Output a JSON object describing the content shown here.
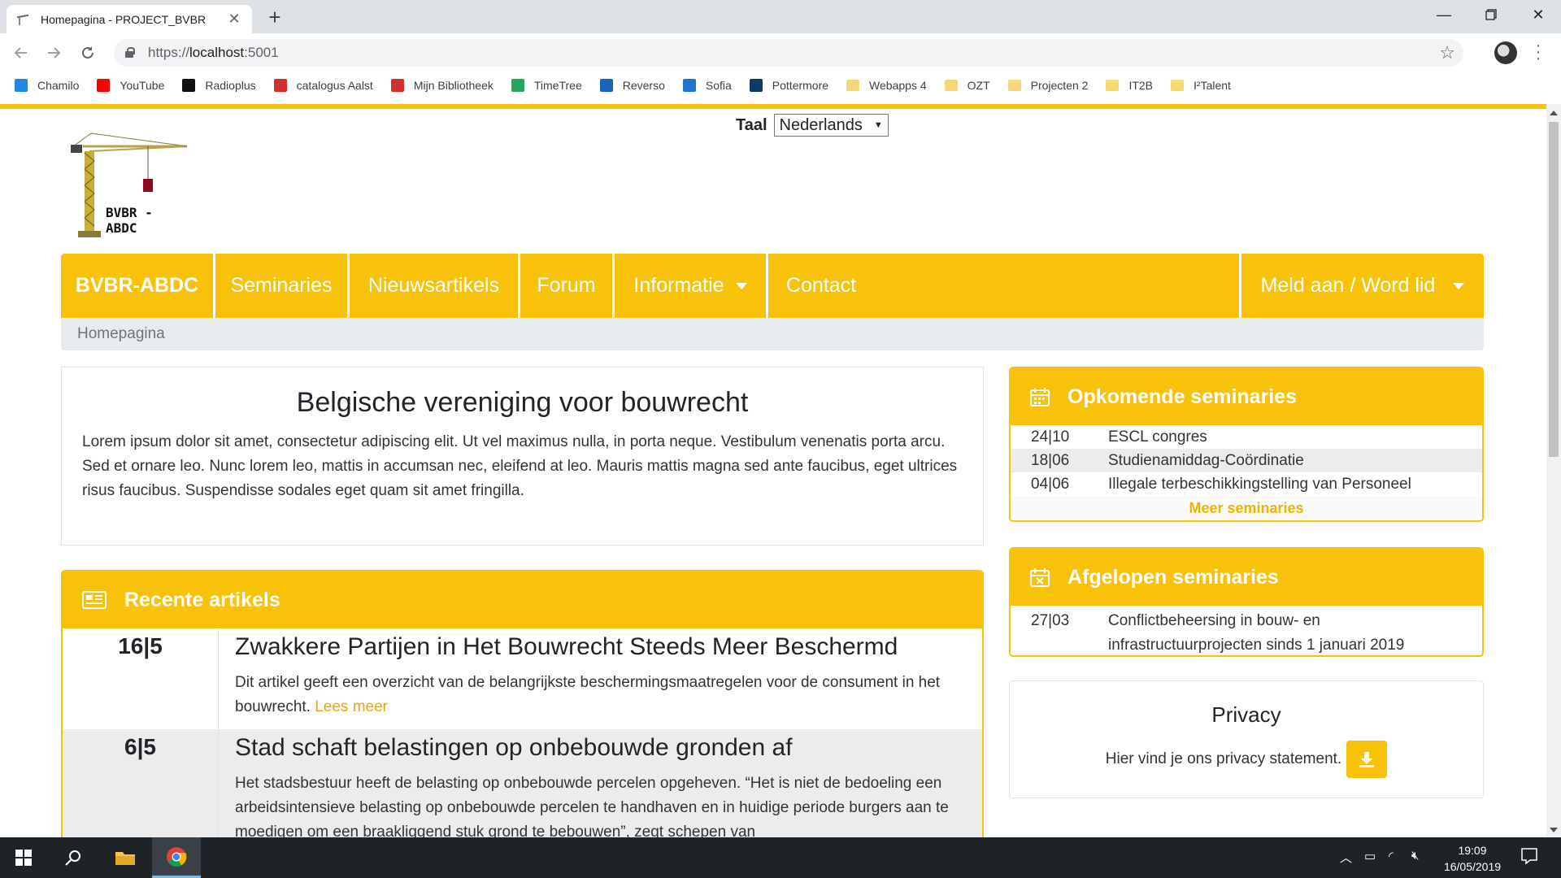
{
  "browser": {
    "tab_title": "Homepagina - PROJECT_BVBR",
    "url_scheme": "https://",
    "url_host": "localhost",
    "url_port": ":5001",
    "bookmarks": [
      {
        "label": "Chamilo",
        "icon": "chamilo-icon",
        "color": "#1e88e5"
      },
      {
        "label": "YouTube",
        "icon": "youtube-icon",
        "color": "#ff0000"
      },
      {
        "label": "Radioplus",
        "icon": "radioplus-icon",
        "color": "#111111"
      },
      {
        "label": "catalogus Aalst",
        "icon": "bib-icon",
        "color": "#d32f2f"
      },
      {
        "label": "Mijn Bibliotheek",
        "icon": "bib-icon",
        "color": "#d32f2f"
      },
      {
        "label": "TimeTree",
        "icon": "timetree-icon",
        "color": "#26a65b"
      },
      {
        "label": "Reverso",
        "icon": "reverso-icon",
        "color": "#1565c0"
      },
      {
        "label": "Sofia",
        "icon": "sofia-icon",
        "color": "#1976d2"
      },
      {
        "label": "Pottermore",
        "icon": "pottermore-icon",
        "color": "#0d3b66"
      },
      {
        "label": "Webapps 4",
        "icon": "folder-icon",
        "color": "#f7d775"
      },
      {
        "label": "OZT",
        "icon": "folder-icon",
        "color": "#f7d775"
      },
      {
        "label": "Projecten 2",
        "icon": "folder-icon",
        "color": "#f7d775"
      },
      {
        "label": "IT2B",
        "icon": "folder-icon",
        "color": "#f7d775"
      },
      {
        "label": "I²Talent",
        "icon": "folder-icon",
        "color": "#f7d775"
      }
    ]
  },
  "page": {
    "accent_color": "#f8c20b",
    "language": {
      "label": "Taal",
      "value": "Nederlands"
    },
    "logo_text": "BVBR - ABDC",
    "nav": {
      "brand": "BVBR-ABDC",
      "items": [
        "Seminaries",
        "Nieuwsartikels",
        "Forum",
        "Informatie",
        "Contact"
      ],
      "account": "Meld aan / Word lid"
    },
    "breadcrumb": "Homepagina",
    "intro": {
      "title": "Belgische vereniging voor bouwrecht",
      "text": "Lorem ipsum dolor sit amet, consectetur adipiscing elit. Ut vel maximus nulla, in porta neque. Vestibulum venenatis porta arcu. Sed et ornare leo. Nunc lorem leo, mattis in accumsan nec, eleifend at leo. Mauris mattis magna sed ante faucibus, eget ultrices risus faucibus. Suspendisse sodales eget quam sit amet fringilla."
    },
    "articles": {
      "heading": "Recente artikels",
      "items": [
        {
          "date": "16|5",
          "title": "Zwakkere Partijen in Het Bouwrecht Steeds Meer Beschermd",
          "text": "Dit artikel geeft een overzicht van de belangrijkste beschermingsmaatregelen voor de consument in het bouwrecht.",
          "link": "Lees meer"
        },
        {
          "date": "6|5",
          "title": "Stad schaft belastingen op onbebouwde gronden af",
          "text": "Het stadsbestuur heeft de belasting op onbebouwde percelen opgeheven. “Het is niet de bedoeling een arbeidsintensieve belasting op onbebouwde percelen te handhaven en in huidige periode burgers aan te moedigen om een braakliggend stuk grond te bebouwen”, zegt schepen van"
        }
      ]
    },
    "upcoming": {
      "heading": "Opkomende seminaries",
      "rows": [
        {
          "date": "24|10",
          "title": "ESCL congres"
        },
        {
          "date": "18|06",
          "title": "Studienamiddag-Coördinatie"
        },
        {
          "date": "04|06",
          "title": "Illegale terbeschikkingstelling van Personeel"
        }
      ],
      "more": "Meer seminaries"
    },
    "past": {
      "heading": "Afgelopen seminaries",
      "rows": [
        {
          "date": "27|03",
          "title": "Conflictbeheersing in bouw- en infrastructuurprojecten sinds 1 januari 2019"
        }
      ]
    },
    "privacy": {
      "heading": "Privacy",
      "text": "Hier vind je ons privacy statement."
    }
  },
  "taskbar": {
    "time": "19:09",
    "date": "16/05/2019"
  }
}
